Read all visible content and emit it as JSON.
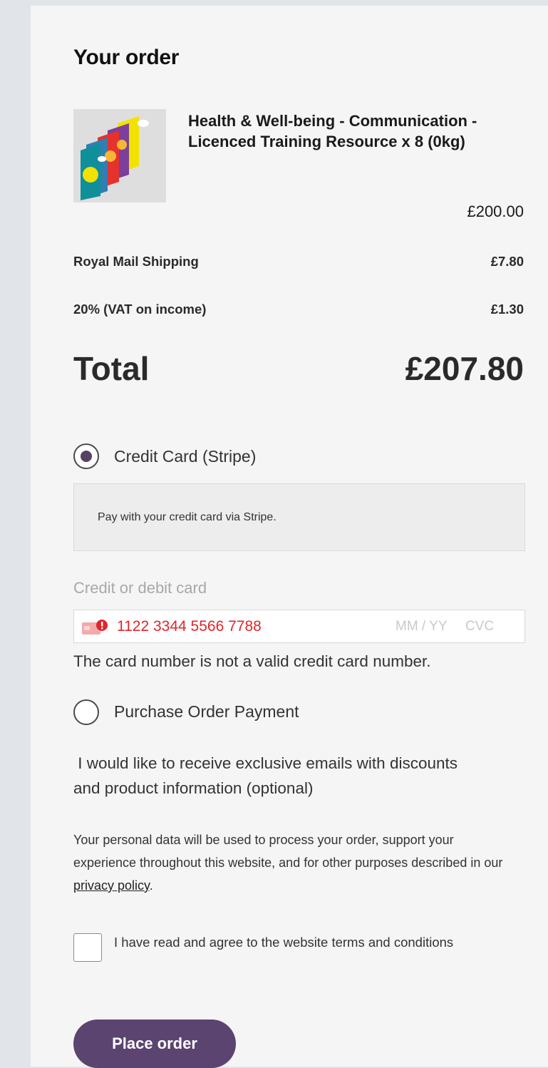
{
  "order": {
    "title": "Your order",
    "product": {
      "name": "Health & Well-being - Communication - Licenced Training Resource x 8 (0kg)",
      "price": "£200.00"
    },
    "rows": [
      {
        "label": "Royal Mail Shipping",
        "value": "£7.80"
      },
      {
        "label": "20% (VAT on income)",
        "value": "£1.30"
      }
    ],
    "total_label": "Total",
    "total_value": "£207.80"
  },
  "payment": {
    "methods": [
      {
        "label": "Credit Card (Stripe)",
        "selected": true
      },
      {
        "label": "Purchase Order Payment",
        "selected": false
      }
    ],
    "stripe_description": "Pay with your credit card via Stripe.",
    "card_label": "Credit or debit card",
    "card_number": "1122 3344 5566 7788",
    "card_expiry_placeholder": "MM / YY",
    "card_cvc_placeholder": "CVC",
    "card_error": "The card number is not a valid credit card number.",
    "error_color": "#e0262b"
  },
  "newsletter_text": " I would like to receive exclusive emails with discounts and product information (optional)",
  "privacy": {
    "text_before": "Your personal data will be used to process your order, support your experience throughout this website, and for other purposes described in our ",
    "link_text": "privacy policy",
    "text_after": "."
  },
  "terms_text": "I have read and agree to the website terms and conditions",
  "place_order_label": "Place order",
  "colors": {
    "accent": "#5b4470",
    "panel": "#f5f5f5",
    "page": "#e1e5e9"
  }
}
